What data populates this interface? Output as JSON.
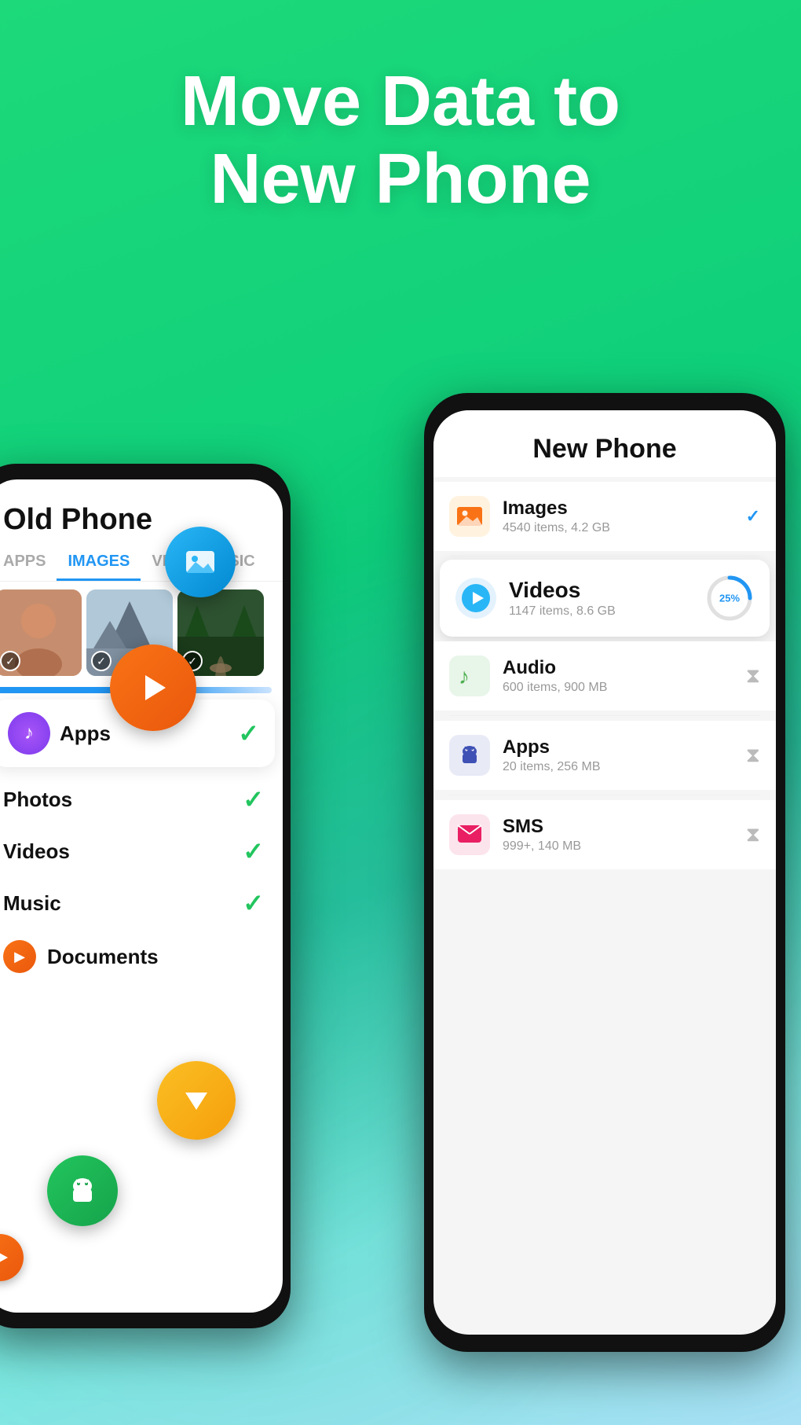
{
  "hero": {
    "title_line1": "Move Data to",
    "title_line2": "New Phone"
  },
  "old_phone": {
    "title": "Old Phone",
    "tabs": [
      "APPS",
      "IMAGES",
      "VI...",
      "MUSIC"
    ],
    "active_tab": "IMAGES",
    "apps_label": "Apps",
    "photos_label": "Photos",
    "videos_label": "Videos",
    "music_label": "Music",
    "documents_label": "Documents"
  },
  "new_phone": {
    "title": "New Phone",
    "items": [
      {
        "name": "Images",
        "meta": "4540 items, 4.2 GB",
        "status": "check",
        "icon_type": "images"
      },
      {
        "name": "Videos",
        "meta": "1147 items, 8.6 GB",
        "status": "25%",
        "icon_type": "videos"
      },
      {
        "name": "Audio",
        "meta": "600 items, 900 MB",
        "status": "hourglass",
        "icon_type": "audio"
      },
      {
        "name": "Apps",
        "meta": "20 items, 256 MB",
        "status": "hourglass",
        "icon_type": "apps"
      },
      {
        "name": "SMS",
        "meta": "999+, 140 MB",
        "status": "hourglass",
        "icon_type": "sms"
      }
    ]
  },
  "bubbles": {
    "photo_icon": "🖼",
    "play_icon": "▶",
    "arrow_down": "▼",
    "android_icon": "🤖",
    "progress_25": "25%"
  }
}
